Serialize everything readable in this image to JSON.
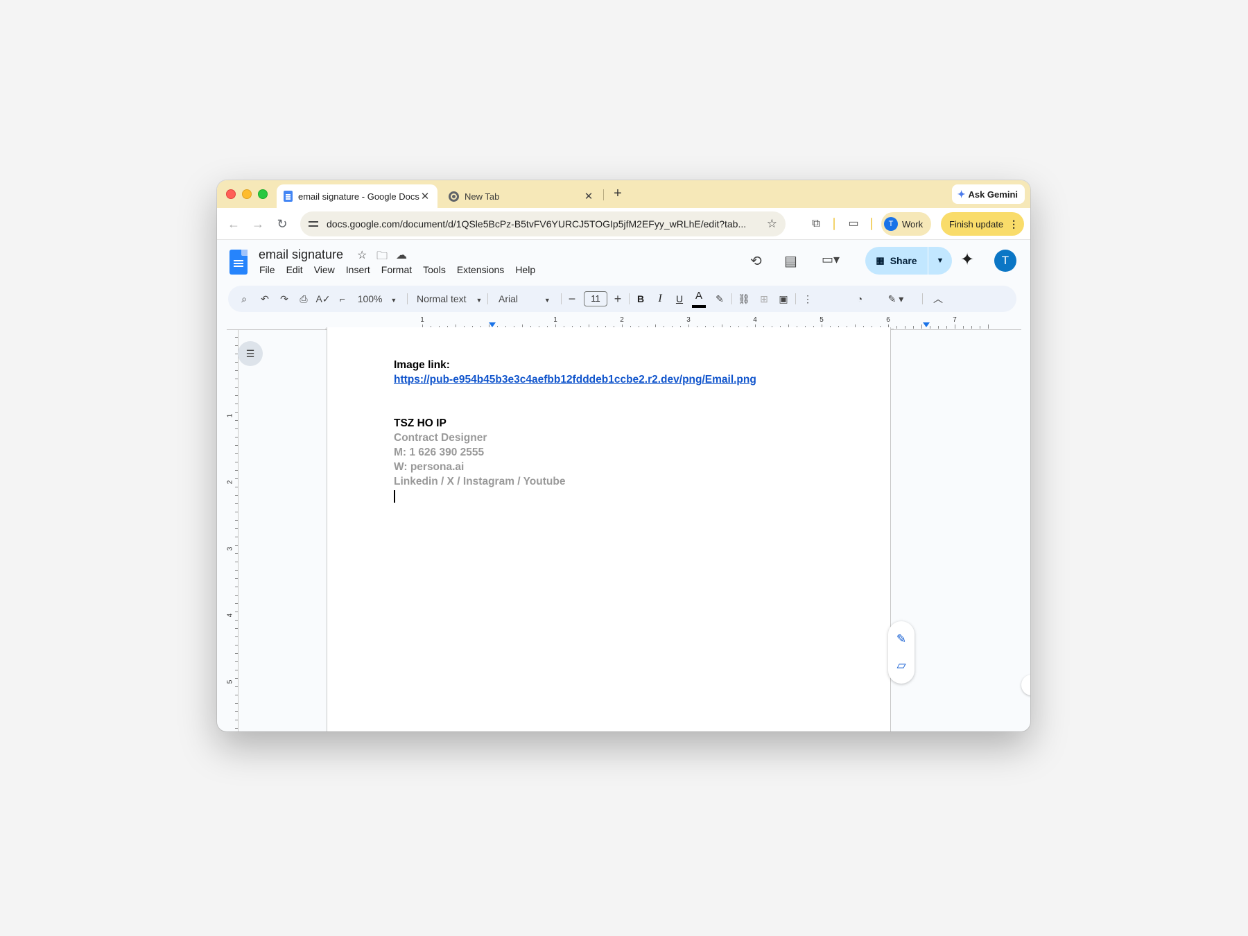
{
  "browser": {
    "tabs": [
      {
        "title": "email signature - Google Docs",
        "close": "✕"
      },
      {
        "title": "New Tab",
        "close": "✕"
      }
    ],
    "new_tab": "+",
    "ask_gemini": "Ask Gemini",
    "url": "docs.google.com/document/d/1QSle5BcPz-B5tvFV6YURCJ5TOGIp5jfM2EFyy_wRLhE/edit?tab...",
    "profile": {
      "avatar": "T",
      "label": "Work"
    },
    "finish_update": "Finish update"
  },
  "docs": {
    "title": "email signature",
    "menu": [
      "File",
      "Edit",
      "View",
      "Insert",
      "Format",
      "Tools",
      "Extensions",
      "Help"
    ],
    "share_label": "Share",
    "account_avatar": "T"
  },
  "format_toolbar": {
    "zoom": "100%",
    "style": "Normal text",
    "font": "Arial",
    "font_size": "11",
    "bold": "B",
    "italic": "I",
    "underline": "U",
    "text_color_glyph": "A",
    "text_color": "#000000"
  },
  "ruler": {
    "horizontal": [
      "1",
      "1",
      "2",
      "3",
      "4",
      "5",
      "6",
      "7"
    ],
    "vertical": [
      "1",
      "2",
      "3",
      "4",
      "5"
    ]
  },
  "document": {
    "image_label": "Image link:",
    "image_url": "https://pub-e954b45b3e3c4aefbb12fdddeb1ccbe2.r2.dev/png/Email.png",
    "name": "TSZ HO IP",
    "role": "Contract Designer",
    "mobile": "M: 1 626 390 2555",
    "website": "W: persona.ai",
    "socials": "Linkedin / X / Instagram / Youtube"
  },
  "colors": {
    "tabstrip": "#f6e8b8",
    "link": "#1155cc",
    "signature_grey": "#999999",
    "share_bg": "#c2e7ff",
    "accent": "#0b57d0"
  },
  "icons": {
    "back": "arrow-left-icon",
    "forward": "arrow-right-icon",
    "reload": "reload-icon",
    "bookmark": "star-icon",
    "extensions": "puzzle-icon",
    "search": "search-icon",
    "undo": "undo-icon",
    "redo": "redo-icon",
    "print": "printer-icon",
    "spellcheck": "spellcheck-icon",
    "paint_format": "paint-format-icon",
    "highlight": "highlighter-icon",
    "link": "link-icon",
    "comment": "add-comment-icon",
    "image": "image-icon",
    "more": "more-vert-icon"
  }
}
